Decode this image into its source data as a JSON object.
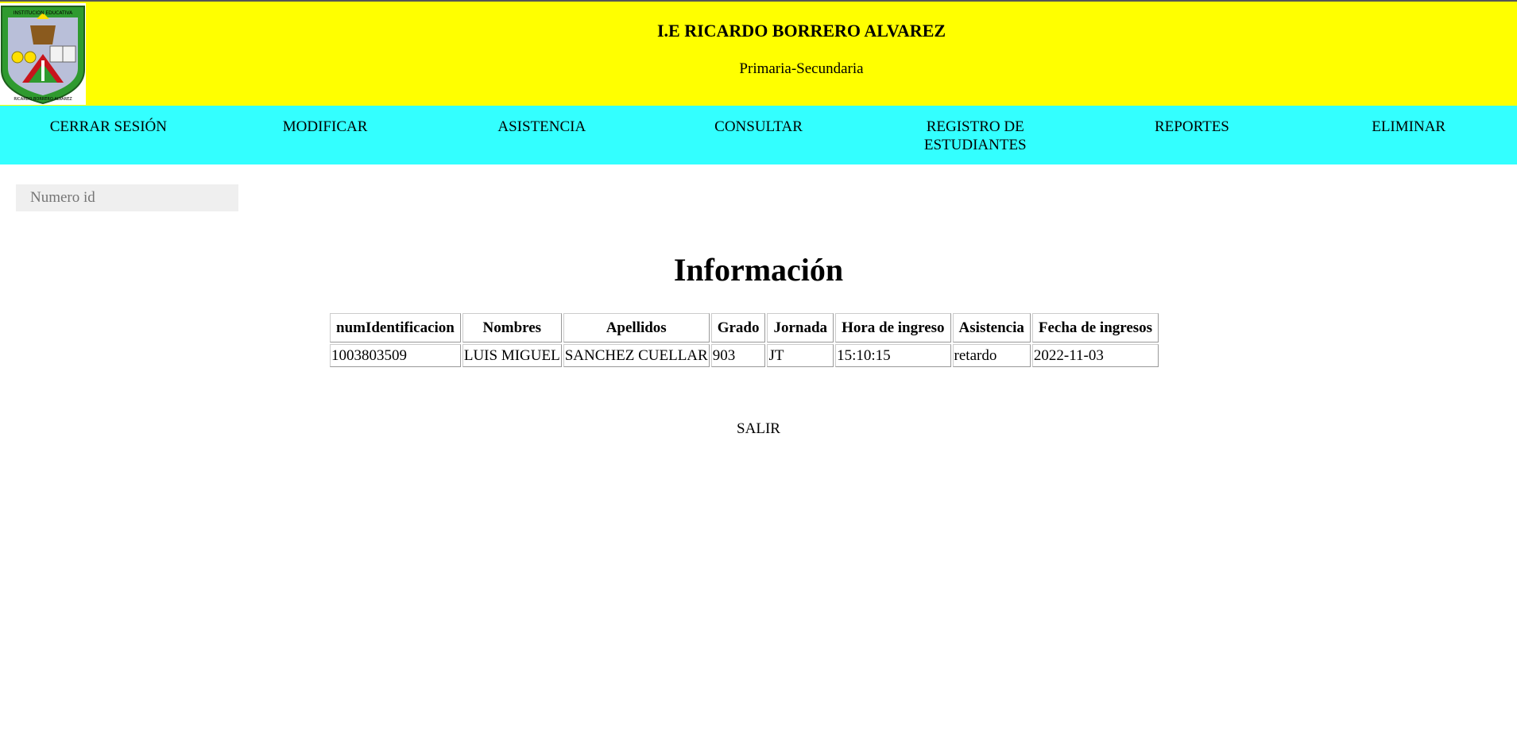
{
  "header": {
    "title": "I.E RICARDO BORRERO ALVAREZ",
    "subtitle": "Primaria-Secundaria",
    "logo_icon": "school-crest-icon",
    "logo_text": "INSTITUCION EDUCATIVA RICARDO BORRERO ALVAREZ",
    "background_color": "#ffff00"
  },
  "nav": {
    "background_color": "#33ffff",
    "items": [
      {
        "label": "CERRAR SESIÓN"
      },
      {
        "label": "MODIFICAR"
      },
      {
        "label": "ASISTENCIA"
      },
      {
        "label": "CONSULTAR"
      },
      {
        "label": "REGISTRO DE ESTUDIANTES"
      },
      {
        "label": "REPORTES"
      },
      {
        "label": "ELIMINAR"
      }
    ]
  },
  "search": {
    "placeholder": "Numero id",
    "value": ""
  },
  "main": {
    "title": "Información",
    "table": {
      "headers": [
        "numIdentificacion",
        "Nombres",
        "Apellidos",
        "Grado",
        "Jornada",
        "Hora de ingreso",
        "Asistencia",
        "Fecha de ingresos"
      ],
      "rows": [
        [
          "1003803509",
          "LUIS MIGUEL",
          "SANCHEZ CUELLAR",
          "903",
          "JT",
          "15:10:15",
          "retardo",
          "2022-11-03"
        ]
      ]
    },
    "exit_label": "SALIR"
  }
}
